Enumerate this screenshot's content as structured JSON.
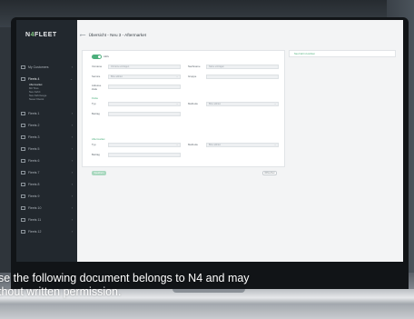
{
  "app": {
    "logo_text": "N4FLEET",
    "page_title": "Übersicht - Neu 3 - Aftermarket",
    "back_icon": "back-arrow-icon"
  },
  "sidebar": {
    "items": [
      {
        "label": "My Customers",
        "active": false
      },
      {
        "label": "Fleets 4",
        "active": true
      },
      {
        "label": "Fleets 1",
        "active": false
      },
      {
        "label": "Fleets 2",
        "active": false
      },
      {
        "label": "Fleets 3",
        "active": false
      },
      {
        "label": "Fleets 5",
        "active": false
      },
      {
        "label": "Fleets 6",
        "active": false
      },
      {
        "label": "Fleets 7",
        "active": false
      },
      {
        "label": "Fleets 8",
        "active": false
      },
      {
        "label": "Fleets 9",
        "active": false
      },
      {
        "label": "Fleets 10",
        "active": false
      },
      {
        "label": "Fleets 11",
        "active": false
      },
      {
        "label": "Fleets 12",
        "active": false
      }
    ],
    "subitems": [
      "Aftermarket",
      "Mit Tires",
      "Neu Fahrt",
      "Neu Fahrzeuge",
      "Neuer Dienst"
    ]
  },
  "form": {
    "toggle_label": "Aktiv",
    "name_label": "Vorname",
    "name_placeholder": "Vorname eintragen",
    "surname_label": "Nachname",
    "surname_placeholder": "Name eintragen",
    "service_label": "Service",
    "service_value": "Bitte wählen",
    "group_label": "Gruppe",
    "address_label": "Adresse Zeile",
    "section1": "Flotte",
    "type_label": "Typ",
    "method_label": "Methode",
    "method_value": "Bitte wählen",
    "date_label": "Beitrag",
    "section2": "Aftermarket",
    "type2_label": "Typ",
    "method2_label": "Methode",
    "method2_value": "Bitte wählen",
    "date2_label": "Beitrag",
    "submit_label": "Speichern",
    "cancel_label": "Abbrechen"
  },
  "right_panel": {
    "title": "Neu Fahrt zuordnen"
  },
  "overlay_caption": {
    "line1": "se the following document belongs to N4 and may",
    "line2": "thout written permission."
  },
  "colors": {
    "accent": "#4caf7c",
    "sidebar_bg": "#22282e",
    "content_bg": "#f3f4f5"
  }
}
